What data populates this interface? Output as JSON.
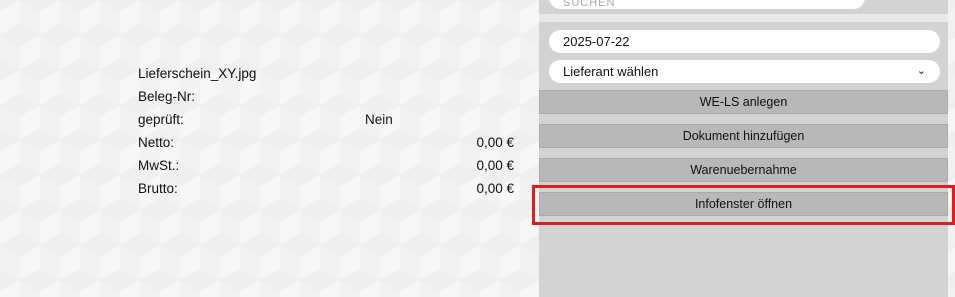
{
  "document": {
    "filename": "Lieferschein_XY.jpg",
    "beleg_label": "Beleg-Nr:",
    "beleg_value": "",
    "geprueft_label": "geprüft:",
    "geprueft_value": "Nein",
    "netto_label": "Netto:",
    "netto_value": "0,00 €",
    "mwst_label": "MwSt.:",
    "mwst_value": "0,00 €",
    "brutto_label": "Brutto:",
    "brutto_value": "0,00 €"
  },
  "sidebar": {
    "search_placeholder": "SUCHEN",
    "date_value": "2025-07-22",
    "supplier_select": "Lieferant wählen",
    "buttons": {
      "create": "WE-LS anlegen",
      "add_document": "Dokument hinzufügen",
      "goods_receipt": "Warenuebernahme",
      "open_info": "Infofenster öffnen"
    }
  },
  "colors": {
    "highlight": "#e31b1b",
    "panel_bg": "#d3d3d3",
    "button_bg": "#b8b8b8"
  }
}
